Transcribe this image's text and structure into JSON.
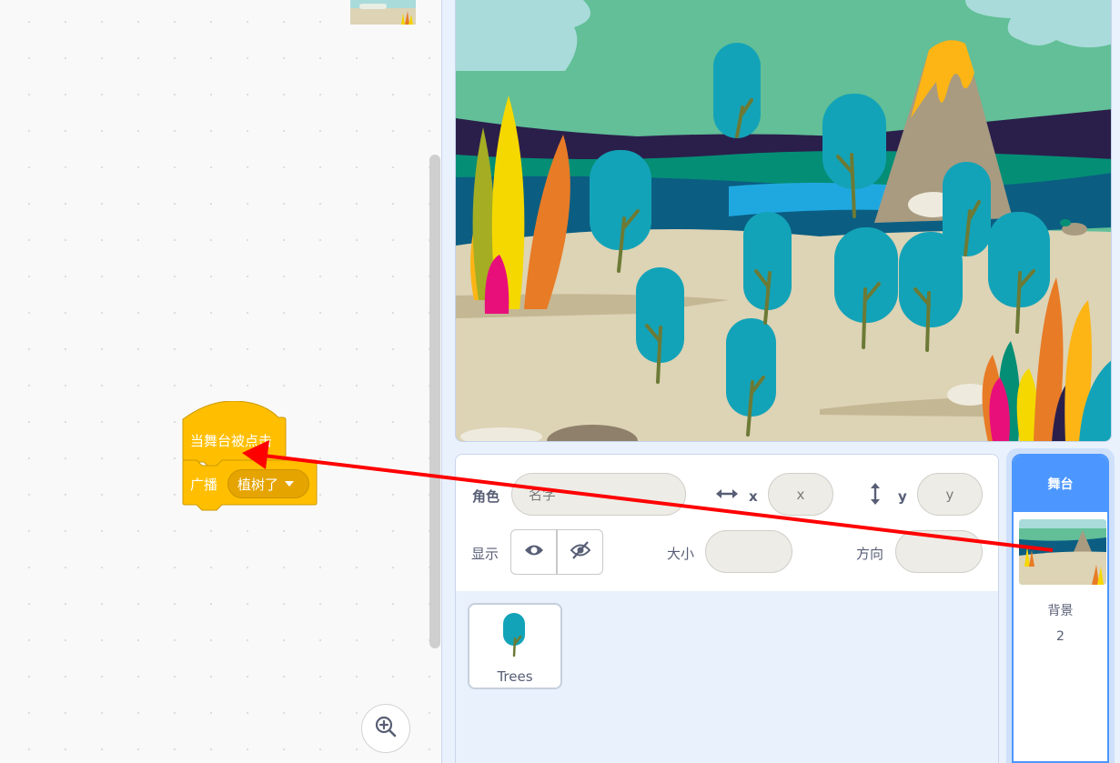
{
  "code_area": {
    "hat_block": {
      "label": "当舞台被点击"
    },
    "broadcast_block": {
      "label": "广播",
      "message": "植树了"
    },
    "zoom_in_icon": "zoom-in-icon"
  },
  "sprite_info": {
    "sprite_label": "角色",
    "name_placeholder": "名字",
    "x_label": "x",
    "x_placeholder": "x",
    "y_label": "y",
    "y_placeholder": "y",
    "show_label": "显示",
    "size_label": "大小",
    "direction_label": "方向"
  },
  "sprites": [
    {
      "name": "Trees"
    }
  ],
  "stage_panel": {
    "title": "舞台",
    "backdrops_label": "背景",
    "backdrop_count": "2"
  },
  "colors": {
    "events_block": "#ffbf00",
    "accent_blue": "#4c97ff",
    "annotation_arrow": "#ff0000"
  }
}
